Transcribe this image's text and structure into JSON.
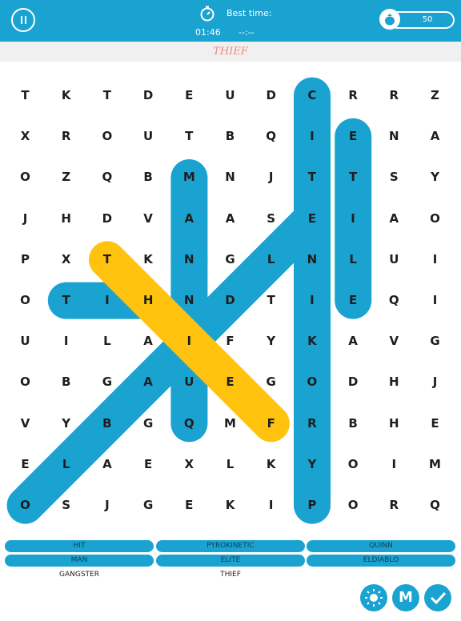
{
  "header": {
    "best_time_label": "Best time:",
    "elapsed_time": "01:46",
    "best_time_value": "--:--",
    "coins": "50",
    "accent_color": "#1aa3d1"
  },
  "current_word": "THIEF",
  "grid": {
    "rows": [
      [
        "T",
        "K",
        "T",
        "D",
        "E",
        "U",
        "D",
        "C",
        "R",
        "R",
        "Z"
      ],
      [
        "X",
        "R",
        "O",
        "U",
        "T",
        "B",
        "Q",
        "I",
        "E",
        "N",
        "A"
      ],
      [
        "O",
        "Z",
        "Q",
        "B",
        "M",
        "N",
        "J",
        "T",
        "T",
        "S",
        "Y"
      ],
      [
        "J",
        "H",
        "D",
        "V",
        "A",
        "A",
        "S",
        "E",
        "I",
        "A",
        "O"
      ],
      [
        "P",
        "X",
        "T",
        "K",
        "N",
        "G",
        "L",
        "N",
        "L",
        "U",
        "I"
      ],
      [
        "O",
        "T",
        "I",
        "H",
        "N",
        "D",
        "T",
        "I",
        "E",
        "Q",
        "I"
      ],
      [
        "U",
        "I",
        "L",
        "A",
        "I",
        "F",
        "Y",
        "K",
        "A",
        "V",
        "G"
      ],
      [
        "O",
        "B",
        "G",
        "A",
        "U",
        "E",
        "G",
        "O",
        "D",
        "H",
        "J"
      ],
      [
        "V",
        "Y",
        "B",
        "G",
        "Q",
        "M",
        "F",
        "R",
        "B",
        "H",
        "E"
      ],
      [
        "E",
        "L",
        "A",
        "E",
        "X",
        "L",
        "K",
        "Y",
        "O",
        "I",
        "M"
      ],
      [
        "O",
        "S",
        "J",
        "G",
        "E",
        "K",
        "I",
        "P",
        "O",
        "R",
        "Q"
      ]
    ],
    "found_color": "#1aa3d1",
    "active_color": "#ffc20e",
    "found_highlights": [
      {
        "word": "PYROKINETIC",
        "from": [
          10,
          7
        ],
        "to": [
          0,
          7
        ]
      },
      {
        "word": "ELITE",
        "from": [
          1,
          8
        ],
        "to": [
          5,
          8
        ]
      },
      {
        "word": "MAN",
        "from": [
          2,
          4
        ],
        "to": [
          4,
          4
        ]
      },
      {
        "word": "HIT",
        "from": [
          5,
          3
        ],
        "to": [
          5,
          1
        ]
      },
      {
        "word": "ELDIABLO",
        "from": [
          3,
          7
        ],
        "to": [
          10,
          0
        ]
      },
      {
        "word": "QUINN",
        "from": [
          8,
          4
        ],
        "to": [
          4,
          4
        ]
      }
    ],
    "active_highlight": {
      "word": "THIEF",
      "from": [
        4,
        2
      ],
      "to": [
        8,
        6
      ]
    }
  },
  "word_list": [
    {
      "label": "HIT",
      "found": true
    },
    {
      "label": "PYROKINETIC",
      "found": true
    },
    {
      "label": "QUINN",
      "found": true
    },
    {
      "label": "MAN",
      "found": true
    },
    {
      "label": "ELITE",
      "found": true
    },
    {
      "label": "ELDIABLO",
      "found": true
    },
    {
      "label": "GANGSTER",
      "found": false
    },
    {
      "label": "THIEF",
      "found": false
    }
  ],
  "actions": {
    "hint_icon": "sun-icon",
    "menu_label": "M",
    "check_icon": "check-icon"
  }
}
